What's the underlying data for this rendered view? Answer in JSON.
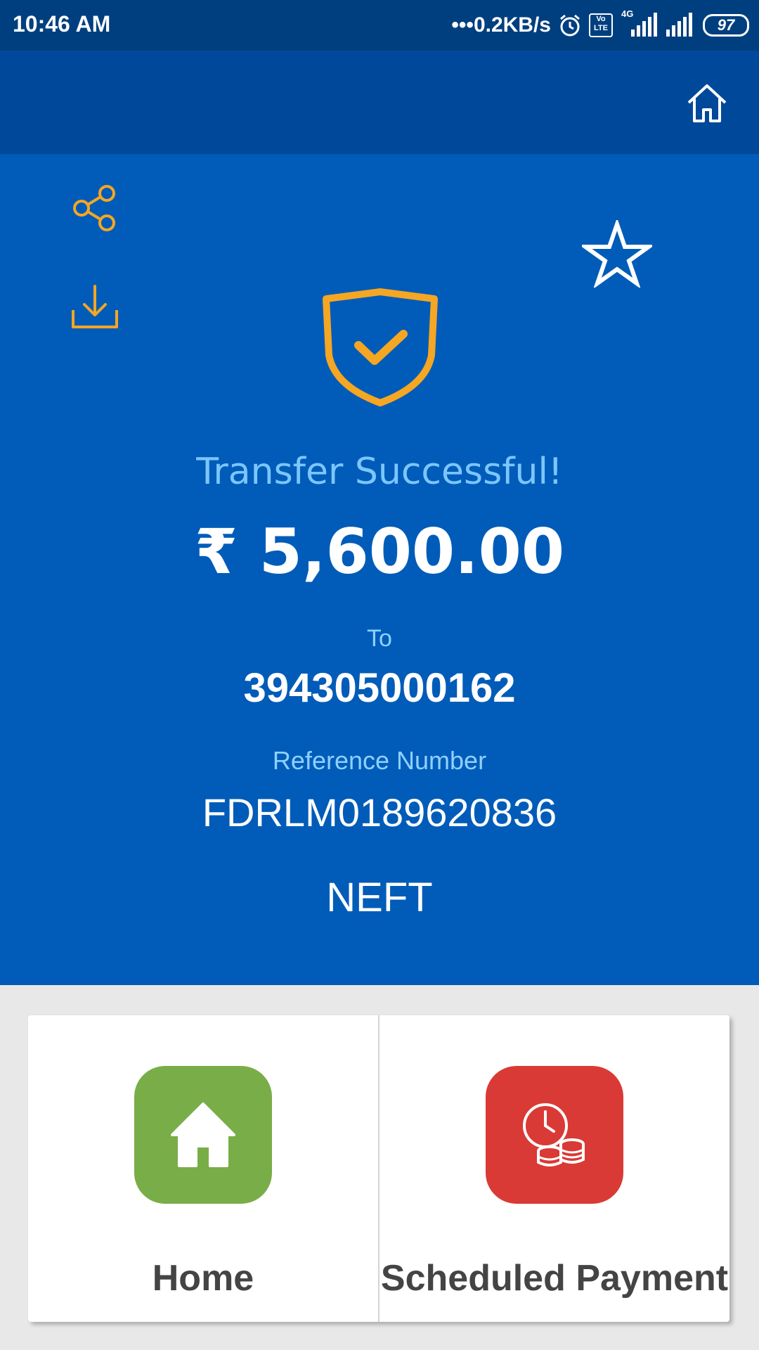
{
  "status_bar": {
    "time": "10:46 AM",
    "network_speed": "0.2KB/s",
    "network_type": "4G",
    "volte": "Vo LTE",
    "battery": "97"
  },
  "header": {
    "home_icon": "home-outline-icon"
  },
  "transfer": {
    "status_title": "Transfer Successful!",
    "amount": "₹ 5,600.00",
    "to_label": "To",
    "to_account": "394305000162",
    "reference_label": "Reference Number",
    "reference_number": "FDRLM0189620836",
    "mode": "NEFT"
  },
  "actions": [
    {
      "label": "Home",
      "icon": "home-icon",
      "color": "#79ad48"
    },
    {
      "label": "Scheduled Payment",
      "icon": "clock-coins-icon",
      "color": "#d93a35"
    }
  ],
  "colors": {
    "status_bar": "#003f7f",
    "app_bar": "#00499a",
    "hero_background": "#005cb8",
    "accent": "#f5a623",
    "light_blue_text": "#7cc6ff"
  }
}
